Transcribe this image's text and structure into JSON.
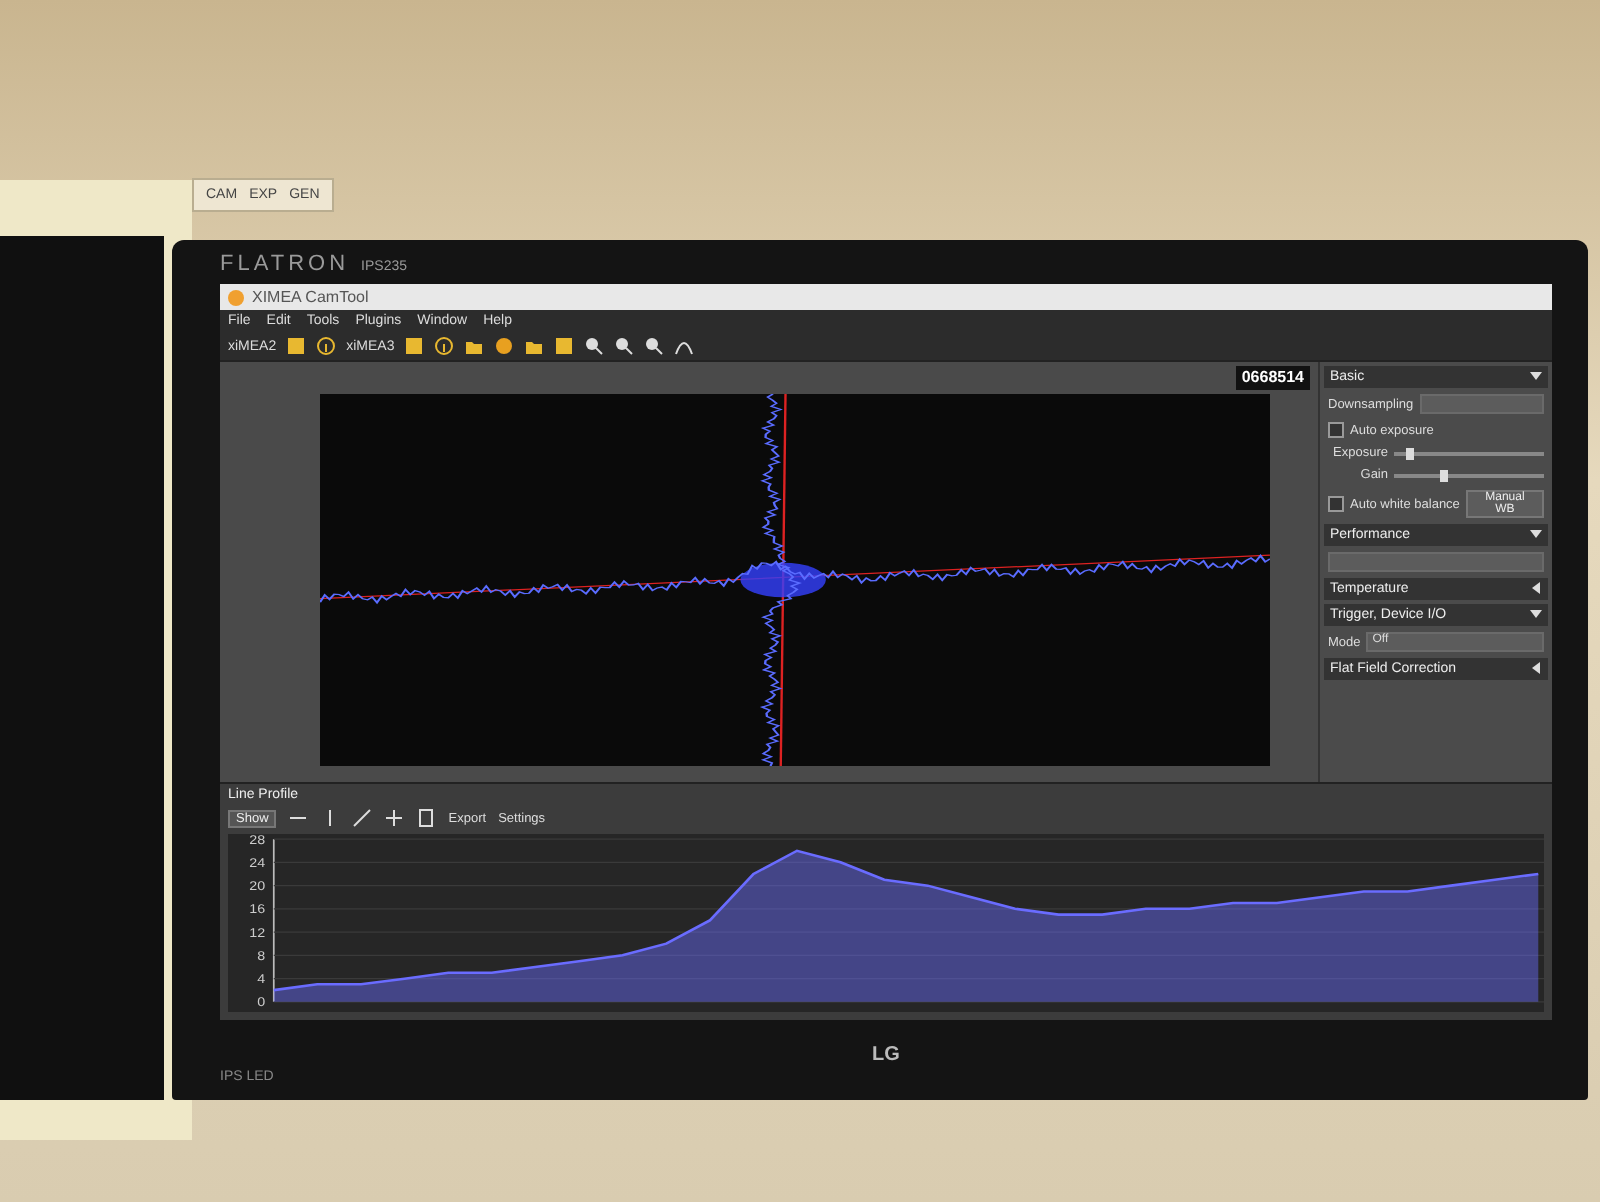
{
  "wall_plate": {
    "labels": [
      "CAM",
      "EXP",
      "GEN"
    ]
  },
  "monitor": {
    "brand": "FLATRON",
    "model": "IPS235",
    "logo": "LG",
    "panel_label": "IPS LED"
  },
  "window": {
    "title": "XIMEA CamTool"
  },
  "menu": [
    "File",
    "Edit",
    "Tools",
    "Plugins",
    "Window",
    "Help"
  ],
  "toolbar": {
    "cameras": [
      "xiMEA2",
      "xiMEA3"
    ]
  },
  "viewer": {
    "counter": "0668514"
  },
  "settings": [
    {
      "kind": "header",
      "label": "Basic",
      "expanded": true
    },
    {
      "kind": "dropdown",
      "label": "Downsampling"
    },
    {
      "kind": "check",
      "label": "Auto exposure",
      "checked": false
    },
    {
      "kind": "slider",
      "label": "Exposure",
      "level": 0.08
    },
    {
      "kind": "slider",
      "label": "Gain",
      "level": 0.3
    },
    {
      "kind": "check",
      "label": "Auto white balance",
      "checked": false,
      "button": "Manual WB"
    },
    {
      "kind": "header",
      "label": "Performance",
      "expanded": true
    },
    {
      "kind": "dropdown"
    },
    {
      "kind": "header",
      "label": "Temperature",
      "expanded": false
    },
    {
      "kind": "header",
      "label": "Trigger, Device I/O",
      "expanded": true
    },
    {
      "kind": "dropdown",
      "label": "Mode",
      "value": "Off"
    },
    {
      "kind": "header",
      "label": "Flat Field Correction",
      "expanded": false
    }
  ],
  "line_profile": {
    "title": "Line Profile",
    "show_button": "Show",
    "export_label": "Export",
    "settings_label": "Settings",
    "chart_data": {
      "type": "area",
      "grid": true,
      "yticks": [
        0,
        4,
        8,
        12,
        16,
        20,
        24,
        28
      ],
      "ylim": [
        0,
        28
      ],
      "series": [
        {
          "color": "#6a6cff",
          "values": [
            2,
            3,
            3,
            4,
            5,
            5,
            6,
            7,
            8,
            10,
            14,
            22,
            26,
            24,
            21,
            20,
            18,
            16,
            15,
            15,
            16,
            16,
            17,
            17,
            18,
            19,
            19,
            20,
            21,
            22
          ]
        }
      ]
    }
  }
}
